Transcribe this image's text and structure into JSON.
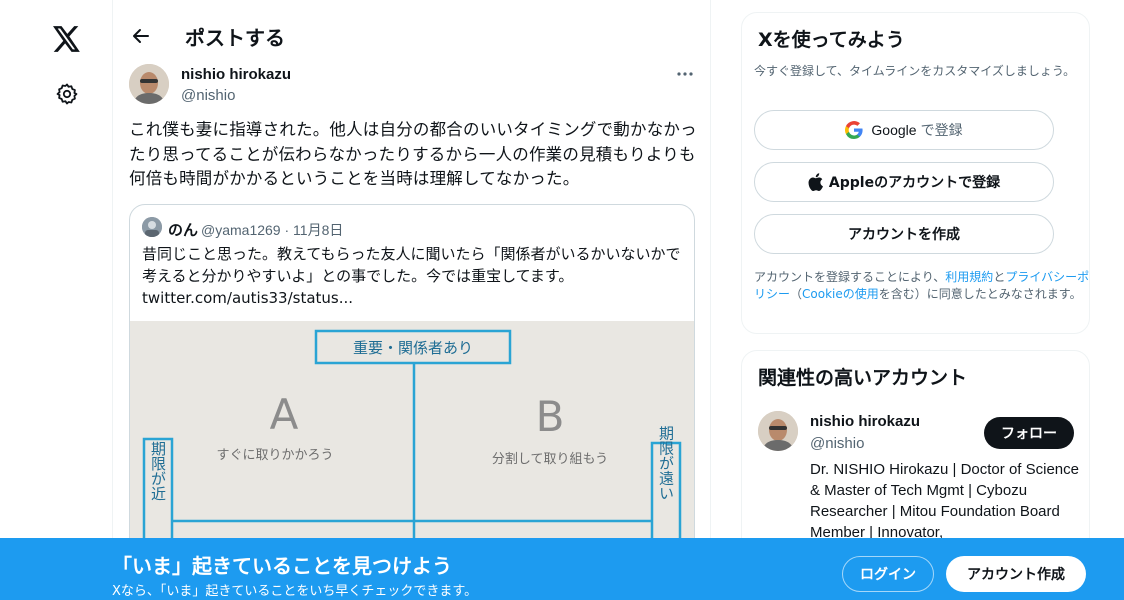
{
  "nav": {
    "logo_icon": "x-logo-icon",
    "settings_icon": "gear-icon"
  },
  "header": {
    "title": "ポストする",
    "back_icon": "arrow-left-icon"
  },
  "post": {
    "author_name": "nishio hirokazu",
    "author_handle": "@nishio",
    "text": "これ僕も妻に指導された。他人は自分の都合のいいタイミングで動かなかったり思ってることが伝わらなかったりするから一人の作業の見積もりよりも何倍も時間がかかるということを当時は理解してなかった。",
    "more_icon": "more-horizontal-icon"
  },
  "quote": {
    "name": "のん",
    "meta": "@yama1269 · 11月8日",
    "text_line1": "昔同じこと思った。教えてもらった友人に聞いたら「関係者がいるかいないかで",
    "text_line2": "考えると分かりやすいよ」との事でした。今では重宝してます。",
    "link": "twitter.com/autis33/status...",
    "image": {
      "header": "重要・関係者あり",
      "cell_a_letter": "A",
      "cell_a_note": "すぐに取りかかろう",
      "cell_b_letter": "B",
      "cell_b_note": "分割して取り組もう",
      "left_label": "期限が近",
      "right_label": "期限が遠い"
    }
  },
  "signup_card": {
    "title": "Xを使ってみよう",
    "subtitle": "今すぐ登録して、タイムラインをカスタマイズしましょう。",
    "google_label": "Google",
    "google_suffix": "で登録",
    "apple_label": "Appleのアカウントで登録",
    "create_label": "アカウントを作成",
    "terms_prefix": "アカウントを登録することにより、",
    "terms_link1": "利用規約",
    "terms_and": "と",
    "terms_link2": "プライバシーポリシー",
    "terms_paren_open": "（",
    "terms_link3": "Cookieの使用",
    "terms_suffix": "を含む）に同意したとみなされます。"
  },
  "related": {
    "title": "関連性の高いアカウント",
    "name": "nishio hirokazu",
    "handle": "@nishio",
    "follow_label": "フォロー",
    "bio": "Dr. NISHIO Hirokazu | Doctor of Science & Master of Tech Mgmt | Cybozu Researcher | Mitou Foundation Board Member | Innovator,"
  },
  "banner": {
    "title": "「いま」起きていることを見つけよう",
    "subtitle": "Xなら、「いま」起きていることをいち早くチェックできます。",
    "login_label": "ログイン",
    "signup_label": "アカウント作成"
  },
  "colors": {
    "accent": "#1d9bf0",
    "text": "#0f1419",
    "muted": "#536471",
    "border": "#cfd9de"
  }
}
